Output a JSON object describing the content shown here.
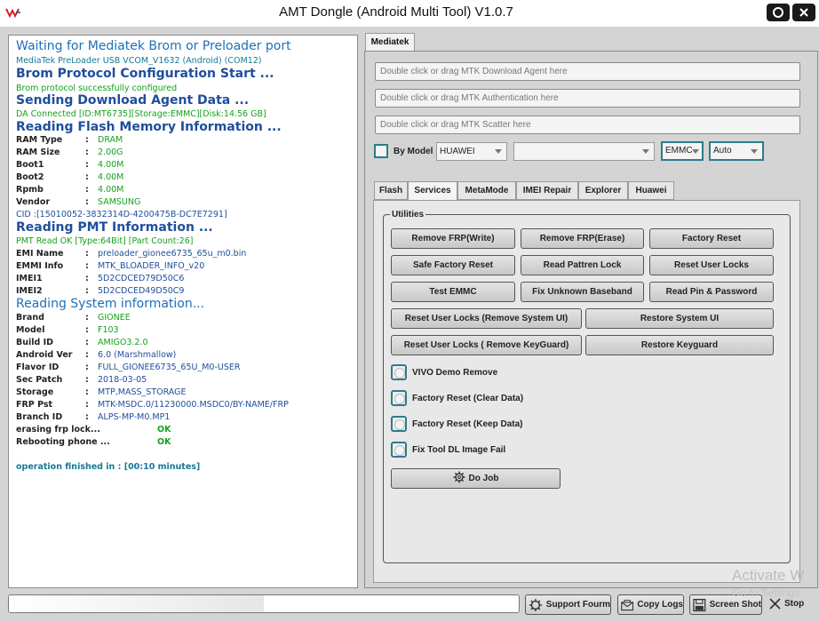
{
  "window": {
    "title": "AMT Dongle (Android Multi Tool) V1.0.7"
  },
  "log": {
    "l1": "Waiting for Mediatek Brom or Preloader port",
    "l2": "MediaTek PreLoader USB VCOM_V1632 (Android) (COM12)",
    "l3": "Brom Protocol Configuration Start ...",
    "l4": "Brom protocol successfully configured",
    "l5": "Sending Download Agent Data ...",
    "l6": "DA Connected [ID:MT6735][Storage:EMMC][Disk:14.56 GB]",
    "l7": "Reading Flash Memory Information ...",
    "flash": [
      {
        "label": "RAM Type",
        "value": "DRAM"
      },
      {
        "label": "RAM Size",
        "value": "2.00G"
      },
      {
        "label": "Boot1",
        "value": "4.00M"
      },
      {
        "label": "Boot2",
        "value": "4.00M"
      },
      {
        "label": "Rpmb",
        "value": "4.00M"
      },
      {
        "label": "Vendor",
        "value": "SAMSUNG"
      }
    ],
    "cid": "CID :[15010052-3832314D-4200475B-DC7E7291]",
    "l8": "Reading PMT Information ...",
    "l9": "PMT Read OK [Type:64Bit] [Part Count:26]",
    "pmt": [
      {
        "label": "EMI Name",
        "value": "preloader_gionee6735_65u_m0.bin"
      },
      {
        "label": "EMMI Info",
        "value": "MTK_BLOADER_INFO_v20"
      },
      {
        "label": "IMEI1",
        "value": "5D2CDCED79D50C6"
      },
      {
        "label": "IMEI2",
        "value": "5D2CDCED49D50C9"
      }
    ],
    "l10": "Reading System information...",
    "sys": [
      {
        "label": "Brand",
        "value": "GIONEE"
      },
      {
        "label": "Model",
        "value": "F103"
      },
      {
        "label": "Build ID",
        "value": "AMIGO3.2.0"
      },
      {
        "label": "Android Ver",
        "value": "6.0 (Marshmallow)"
      },
      {
        "label": "Flavor ID",
        "value": "FULL_GIONEE6735_65U_M0-USER"
      },
      {
        "label": "Sec Patch",
        "value": "2018-03-05"
      },
      {
        "label": "Storage",
        "value": "MTP,MASS_STORAGE"
      },
      {
        "label": "FRP Pst",
        "value": "MTK-MSDC.0/11230000.MSDC0/BY-NAME/FRP"
      },
      {
        "label": "Branch ID",
        "value": "ALPS-MP-M0.MP1"
      }
    ],
    "erase_label": "erasing frp lock...",
    "erase_status": "OK",
    "reboot_label": "Rebooting phone ...",
    "reboot_status": "OK",
    "finish": "operation finished in : [00:10 minutes]"
  },
  "tabs": {
    "main": "Mediatek",
    "sub": [
      "Flash",
      "Services",
      "MetaMode",
      "IMEI Repair",
      "Explorer",
      "Huawei"
    ]
  },
  "fields": {
    "da": "Double click or drag MTK Download Agent here",
    "auth": "Double click or drag MTK Authentication here",
    "scatter": "Double click or drag MTK Scatter here",
    "by_model": "By Model",
    "brand": "HUAWEI",
    "model": "",
    "storage": "EMMC",
    "mode": "Auto"
  },
  "utilities": {
    "title": "Utilities",
    "b1": "Remove FRP(Write)",
    "b2": "Remove FRP(Erase)",
    "b3": "Factory Reset",
    "b4": "Safe Factory Reset",
    "b5": "Read Pattren Lock",
    "b6": "Reset User Locks",
    "b7": "Test EMMC",
    "b8": "Fix Unknown Baseband",
    "b9": "Read Pin & Password",
    "b10": "Reset User Locks (Remove System UI)",
    "b11": "Restore System UI",
    "b12": "Reset User Locks ( Remove KeyGuard)",
    "b13": "Restore Keyguard",
    "c1": "VIVO Demo Remove",
    "c2": "Factory Reset (Clear Data)",
    "c3": "Factory Reset (Keep Data)",
    "c4": "Fix Tool DL Image Fail",
    "do_job": "Do Job"
  },
  "bottom": {
    "progress": 0.5,
    "support": "Support Fourm",
    "copy_logs": "Copy Logs",
    "screenshot": "Screen Shot",
    "stop": "Stop"
  },
  "watermark": {
    "line1": "Activate W",
    "line2": "Go to Settings"
  }
}
